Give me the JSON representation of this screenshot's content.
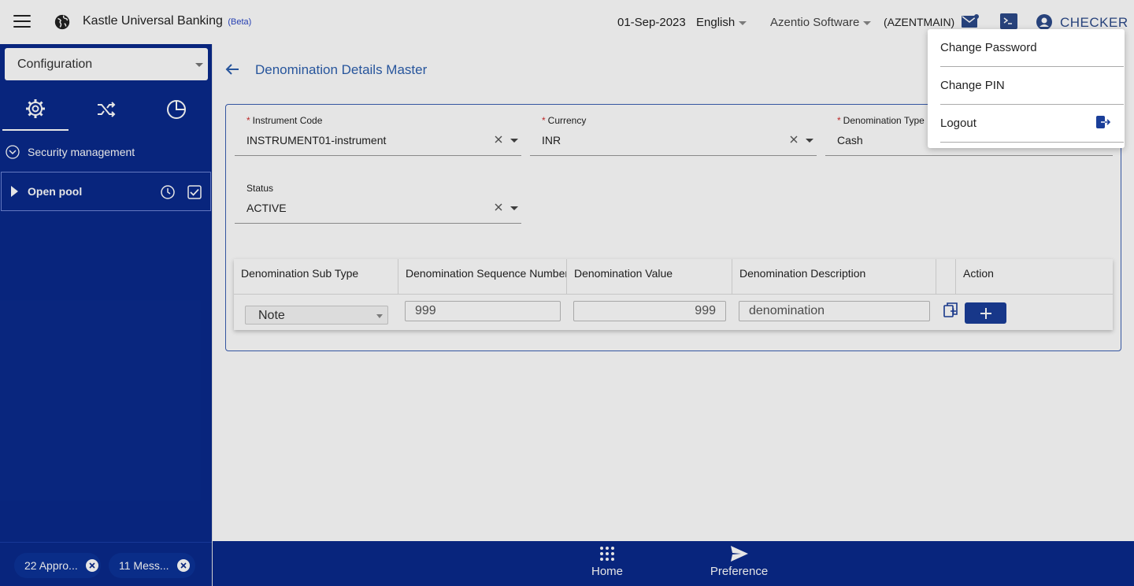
{
  "header": {
    "app_title": "Kastle Universal Banking",
    "beta": "(Beta)",
    "date": "01-Sep-2023",
    "language": "English",
    "company": "Azentio Software",
    "company_code": "(AZENTMAIN)",
    "user": "CHECKER"
  },
  "sidebar": {
    "module": "Configuration",
    "section": "Security management",
    "pool": "Open pool",
    "chips": [
      {
        "label": "22 Appro..."
      },
      {
        "label": "11 Mess..."
      }
    ]
  },
  "page": {
    "title": "Denomination Details Master"
  },
  "form": {
    "instrument_code": {
      "label": "Instrument Code",
      "required": "*",
      "value": "INSTRUMENT01-instrument"
    },
    "currency": {
      "label": "Currency",
      "required": "*",
      "value": "INR"
    },
    "denomination_type": {
      "label": "Denomination Type",
      "required": "*",
      "value": "Cash"
    },
    "status": {
      "label": "Status",
      "value": "ACTIVE"
    }
  },
  "grid": {
    "columns": [
      "Denomination Sub Type",
      "Denomination Sequence Number",
      "Denomination Value",
      "Denomination Description",
      "",
      "Action"
    ],
    "row": {
      "sub_type": "Note",
      "sequence": "999",
      "value": "999",
      "description": "denomination"
    }
  },
  "bottom_nav": {
    "home": "Home",
    "preference": "Preference"
  },
  "user_menu": {
    "items": [
      "Change Password",
      "Change PIN",
      "Logout"
    ]
  },
  "colors": {
    "sidebar": "#0a2a8c",
    "accent": "#1a3e99",
    "title": "#2c5fae"
  }
}
